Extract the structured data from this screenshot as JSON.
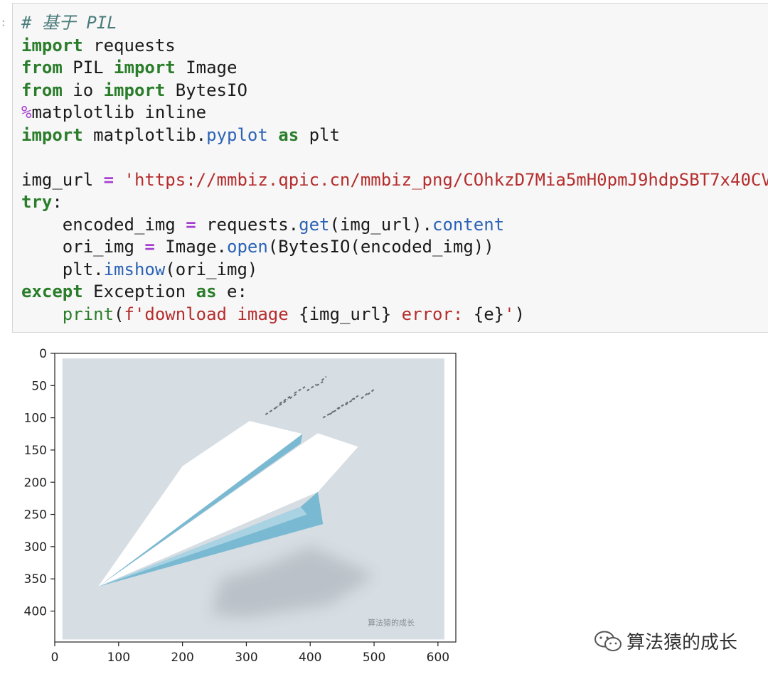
{
  "cell": {
    "prompt": ":",
    "lines": [
      [
        {
          "t": "# 基于 PIL",
          "c": "cmt"
        }
      ],
      [
        {
          "t": "import",
          "c": "kw"
        },
        {
          "t": " requests",
          "c": ""
        }
      ],
      [
        {
          "t": "from",
          "c": "kw"
        },
        {
          "t": " PIL ",
          "c": ""
        },
        {
          "t": "import",
          "c": "kw"
        },
        {
          "t": " Image",
          "c": ""
        }
      ],
      [
        {
          "t": "from",
          "c": "kw"
        },
        {
          "t": " io ",
          "c": ""
        },
        {
          "t": "import",
          "c": "kw"
        },
        {
          "t": " BytesIO",
          "c": ""
        }
      ],
      [
        {
          "t": "%",
          "c": "magic"
        },
        {
          "t": "matplotlib inline",
          "c": ""
        }
      ],
      [
        {
          "t": "import",
          "c": "kw"
        },
        {
          "t": " matplotlib.",
          "c": ""
        },
        {
          "t": "pyplot",
          "c": "fn"
        },
        {
          "t": " ",
          "c": ""
        },
        {
          "t": "as",
          "c": "kw"
        },
        {
          "t": " plt",
          "c": ""
        }
      ],
      [
        {
          "t": "",
          "c": ""
        }
      ],
      [
        {
          "t": "img_url ",
          "c": ""
        },
        {
          "t": "=",
          "c": "op"
        },
        {
          "t": " ",
          "c": ""
        },
        {
          "t": "'https://mmbiz.qpic.cn/mmbiz_png/COhkzD7Mia5mH0pmJ9hdpSBT7x40CV",
          "c": "str"
        }
      ],
      [
        {
          "t": "try",
          "c": "kw"
        },
        {
          "t": ":",
          "c": ""
        }
      ],
      [
        {
          "t": "    encoded_img ",
          "c": ""
        },
        {
          "t": "=",
          "c": "op"
        },
        {
          "t": " requests.",
          "c": ""
        },
        {
          "t": "get",
          "c": "fn"
        },
        {
          "t": "(img_url).",
          "c": ""
        },
        {
          "t": "content",
          "c": "fn"
        }
      ],
      [
        {
          "t": "    ori_img ",
          "c": ""
        },
        {
          "t": "=",
          "c": "op"
        },
        {
          "t": " Image.",
          "c": ""
        },
        {
          "t": "open",
          "c": "fn"
        },
        {
          "t": "(BytesIO(encoded_img))",
          "c": ""
        }
      ],
      [
        {
          "t": "    plt.",
          "c": ""
        },
        {
          "t": "imshow",
          "c": "fn"
        },
        {
          "t": "(ori_img)",
          "c": ""
        }
      ],
      [
        {
          "t": "except",
          "c": "kw"
        },
        {
          "t": " Exception ",
          "c": ""
        },
        {
          "t": "as",
          "c": "kw"
        },
        {
          "t": " e:",
          "c": ""
        }
      ],
      [
        {
          "t": "    ",
          "c": ""
        },
        {
          "t": "print",
          "c": "kw2"
        },
        {
          "t": "(",
          "c": ""
        },
        {
          "t": "f'download image ",
          "c": "str"
        },
        {
          "t": "{img_url}",
          "c": ""
        },
        {
          "t": " error: ",
          "c": "str"
        },
        {
          "t": "{e}",
          "c": ""
        },
        {
          "t": "'",
          "c": "str"
        },
        {
          "t": ")",
          "c": ""
        }
      ]
    ]
  },
  "output": {
    "x_ticks": [
      0,
      100,
      200,
      300,
      400,
      500,
      600
    ],
    "y_ticks": [
      0,
      50,
      100,
      150,
      200,
      250,
      300,
      350,
      400
    ],
    "x_range": [
      0,
      628
    ],
    "y_range": [
      0,
      448
    ],
    "image_background": "#d6dde3",
    "plane_color_light": "#ffffff",
    "plane_color_dark": "#7ab9d2",
    "shadow_color": "#b8bfc6",
    "image_watermark": "算法猿的成长"
  },
  "watermark": {
    "icon": "wechat-icon",
    "text": "算法猿的成长"
  }
}
